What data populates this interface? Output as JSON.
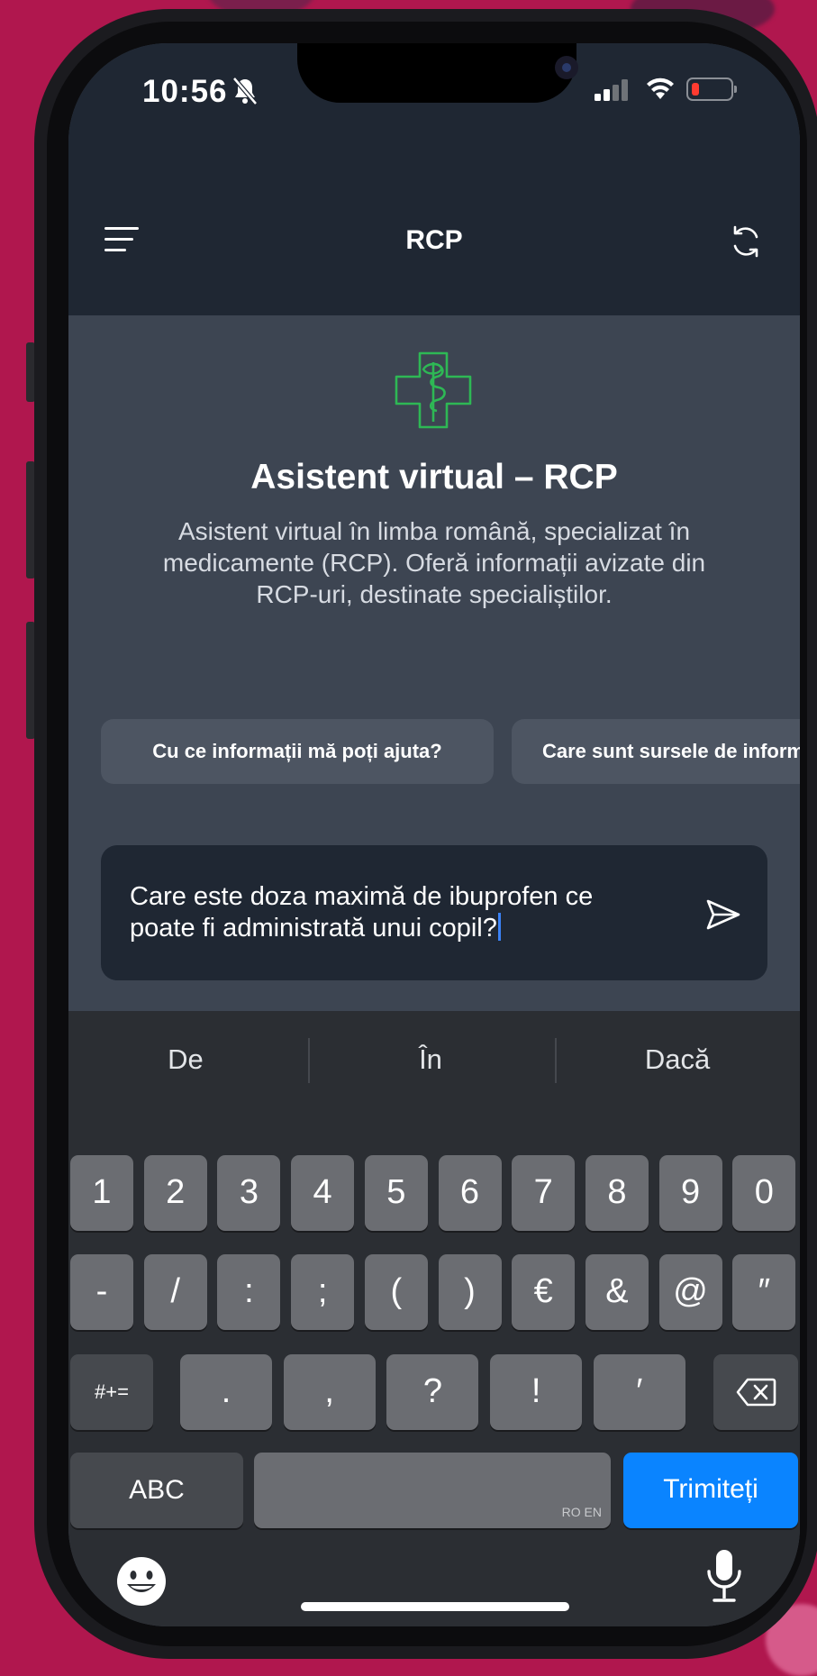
{
  "status_bar": {
    "time": "10:56"
  },
  "nav": {
    "title": "RCP"
  },
  "hero": {
    "title": "Asistent virtual – RCP",
    "description": "Asistent virtual în limba română, specializat în medicamente (RCP). Oferă informații avizate din RCP-uri, destinate specialiștilor."
  },
  "suggestion_chips": [
    {
      "label": "Cu ce informații mă poți ajuta?"
    },
    {
      "label": "Care sunt sursele de informații?"
    }
  ],
  "composer": {
    "value": "Care este doza maximă de ibuprofen ce poate fi administrată unui copil?"
  },
  "keyboard": {
    "suggestions": [
      "De",
      "În",
      "Dacă"
    ],
    "row1": [
      "1",
      "2",
      "3",
      "4",
      "5",
      "6",
      "7",
      "8",
      "9",
      "0"
    ],
    "row2": [
      "-",
      "/",
      ":",
      ";",
      "(",
      ")",
      "€",
      "&",
      "@",
      "″"
    ],
    "row3": [
      "#+=",
      ".",
      ",",
      "?",
      "!",
      "′"
    ],
    "abc_label": "ABC",
    "space_lang": "RO EN",
    "send_label": "Trimiteți"
  },
  "colors": {
    "accent_green": "#2eb855",
    "send_key_blue": "#0a84ff",
    "background_magenta": "#b0174e"
  }
}
